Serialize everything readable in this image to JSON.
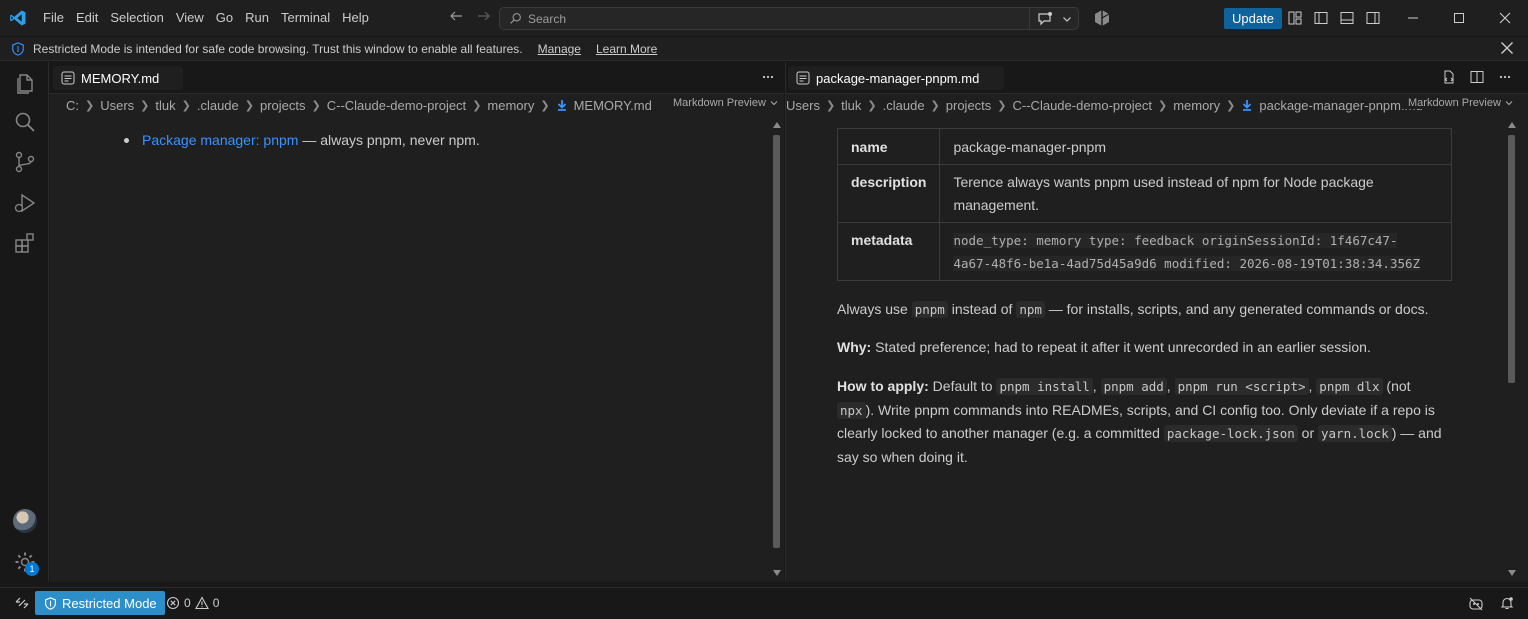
{
  "menu": [
    "File",
    "Edit",
    "Selection",
    "View",
    "Go",
    "Run",
    "Terminal",
    "Help"
  ],
  "search": {
    "placeholder": "Search"
  },
  "titlebar": {
    "update_label": "Update"
  },
  "banner": {
    "text": "Restricted Mode is intended for safe code browsing. Trust this window to enable all features.",
    "manage": "Manage",
    "learn_more": "Learn More"
  },
  "left_editor": {
    "tab_label": "MEMORY.md",
    "breadcrumb": [
      "C:",
      "Users",
      "tluk",
      ".claude",
      "projects",
      "C--Claude-demo-project",
      "memory"
    ],
    "breadcrumb_file": "MEMORY.md",
    "preview_label": "Markdown Preview",
    "list": [
      {
        "link": "Package manager: pnpm",
        "text": " — always pnpm, never npm."
      }
    ]
  },
  "right_editor": {
    "tab_label": "package-manager-pnpm.md",
    "breadcrumb": [
      "Users",
      "tluk",
      ".claude",
      "projects",
      "C--Claude-demo-project",
      "memory"
    ],
    "breadcrumb_file": "package-manager-pnpm.md",
    "preview_label": "Markdown Preview",
    "frontmatter": {
      "name_key": "name",
      "name_val": "package-manager-pnpm",
      "description_key": "description",
      "description_val_1": "Terence always wants pnpm used instead of npm for Node package",
      "description_val_2": "management.",
      "metadata_key": "metadata",
      "metadata_val_1": "node_type: memory type: feedback originSessionId: 1f467c47-",
      "metadata_val_2": "4a67-48f6-be1a-4ad75d45a9d6 modified: 2026-08-19T01:38:34.356Z"
    },
    "p1": {
      "a": "Always use ",
      "code1": "pnpm",
      "b": " instead of ",
      "code2": "npm",
      "c": " — for installs, scripts, and any generated commands or docs."
    },
    "p2": {
      "label": "Why:",
      "text": " Stated preference; had to repeat it after it went unrecorded in an earlier session."
    },
    "p3": {
      "label": "How to apply:",
      "a": " Default to ",
      "c1": "pnpm install",
      "s1": ", ",
      "c2": "pnpm add",
      "s2": ", ",
      "c3": "pnpm run <script>",
      "s3": ", ",
      "c4": "pnpm dlx",
      "b": " (not",
      "c5": "npx",
      "d": "). Write pnpm commands into READMEs, scripts, and CI config too. Only deviate if a repo is",
      "e": "clearly locked to another manager (e.g. a committed ",
      "c6": "package-lock.json",
      "f": " or ",
      "c7": "yarn.lock",
      "g": ") — and",
      "h": "say so when doing it."
    }
  },
  "statusbar": {
    "restricted": "Restricted Mode",
    "errors": "0",
    "warnings": "0",
    "settings_badge": "1"
  },
  "colors": {
    "accent": "#0078d4",
    "link": "#3794ff",
    "restricted_bg": "#2c8fc9",
    "update_bg": "#0e639c"
  }
}
